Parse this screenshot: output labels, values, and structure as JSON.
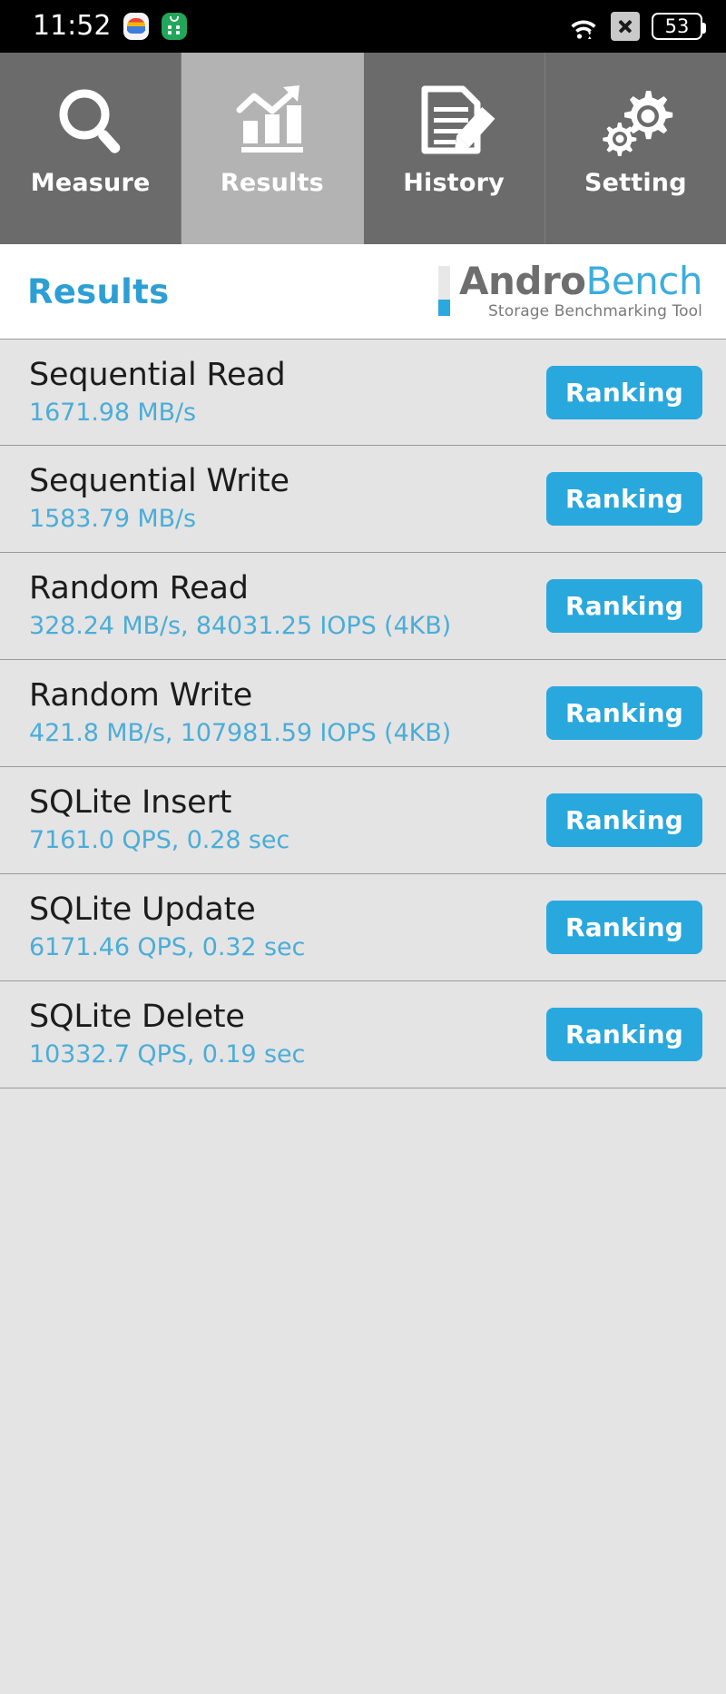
{
  "statusbar": {
    "time": "11:52",
    "battery_level": "53",
    "icons": {
      "app_rainbow": "rainbow-app-icon",
      "app_store": "green-store-app-icon",
      "wifi": "wifi-icon",
      "sim": "sim-card-disabled-icon",
      "battery": "battery-icon"
    }
  },
  "tabs": [
    {
      "label": "Measure",
      "icon": "magnifier-icon",
      "active": false
    },
    {
      "label": "Results",
      "icon": "bar-chart-trend-icon",
      "active": true
    },
    {
      "label": "History",
      "icon": "document-pencil-icon",
      "active": false
    },
    {
      "label": "Setting",
      "icon": "gears-icon",
      "active": false
    }
  ],
  "header": {
    "title": "Results",
    "brand_primary": "Andro",
    "brand_secondary": "Bench",
    "brand_tagline": "Storage Benchmarking Tool"
  },
  "results": {
    "ranking_label": "Ranking",
    "rows": [
      {
        "name": "Sequential Read",
        "value": "1671.98 MB/s"
      },
      {
        "name": "Sequential Write",
        "value": "1583.79 MB/s"
      },
      {
        "name": "Random Read",
        "value": "328.24 MB/s, 84031.25 IOPS (4KB)"
      },
      {
        "name": "Random Write",
        "value": "421.8 MB/s, 107981.59 IOPS (4KB)"
      },
      {
        "name": "SQLite Insert",
        "value": "7161.0 QPS, 0.28 sec"
      },
      {
        "name": "SQLite Update",
        "value": "6171.46 QPS, 0.32 sec"
      },
      {
        "name": "SQLite Delete",
        "value": "10332.7 QPS, 0.19 sec"
      }
    ]
  },
  "colors": {
    "accent_blue": "#29a8de",
    "value_blue": "#4badd8",
    "title_blue": "#2e9fd4",
    "tab_inactive": "#6b6b6b",
    "tab_active": "#b3b3b3",
    "list_bg": "#e4e4e4",
    "statusbar_bg": "#000000"
  }
}
